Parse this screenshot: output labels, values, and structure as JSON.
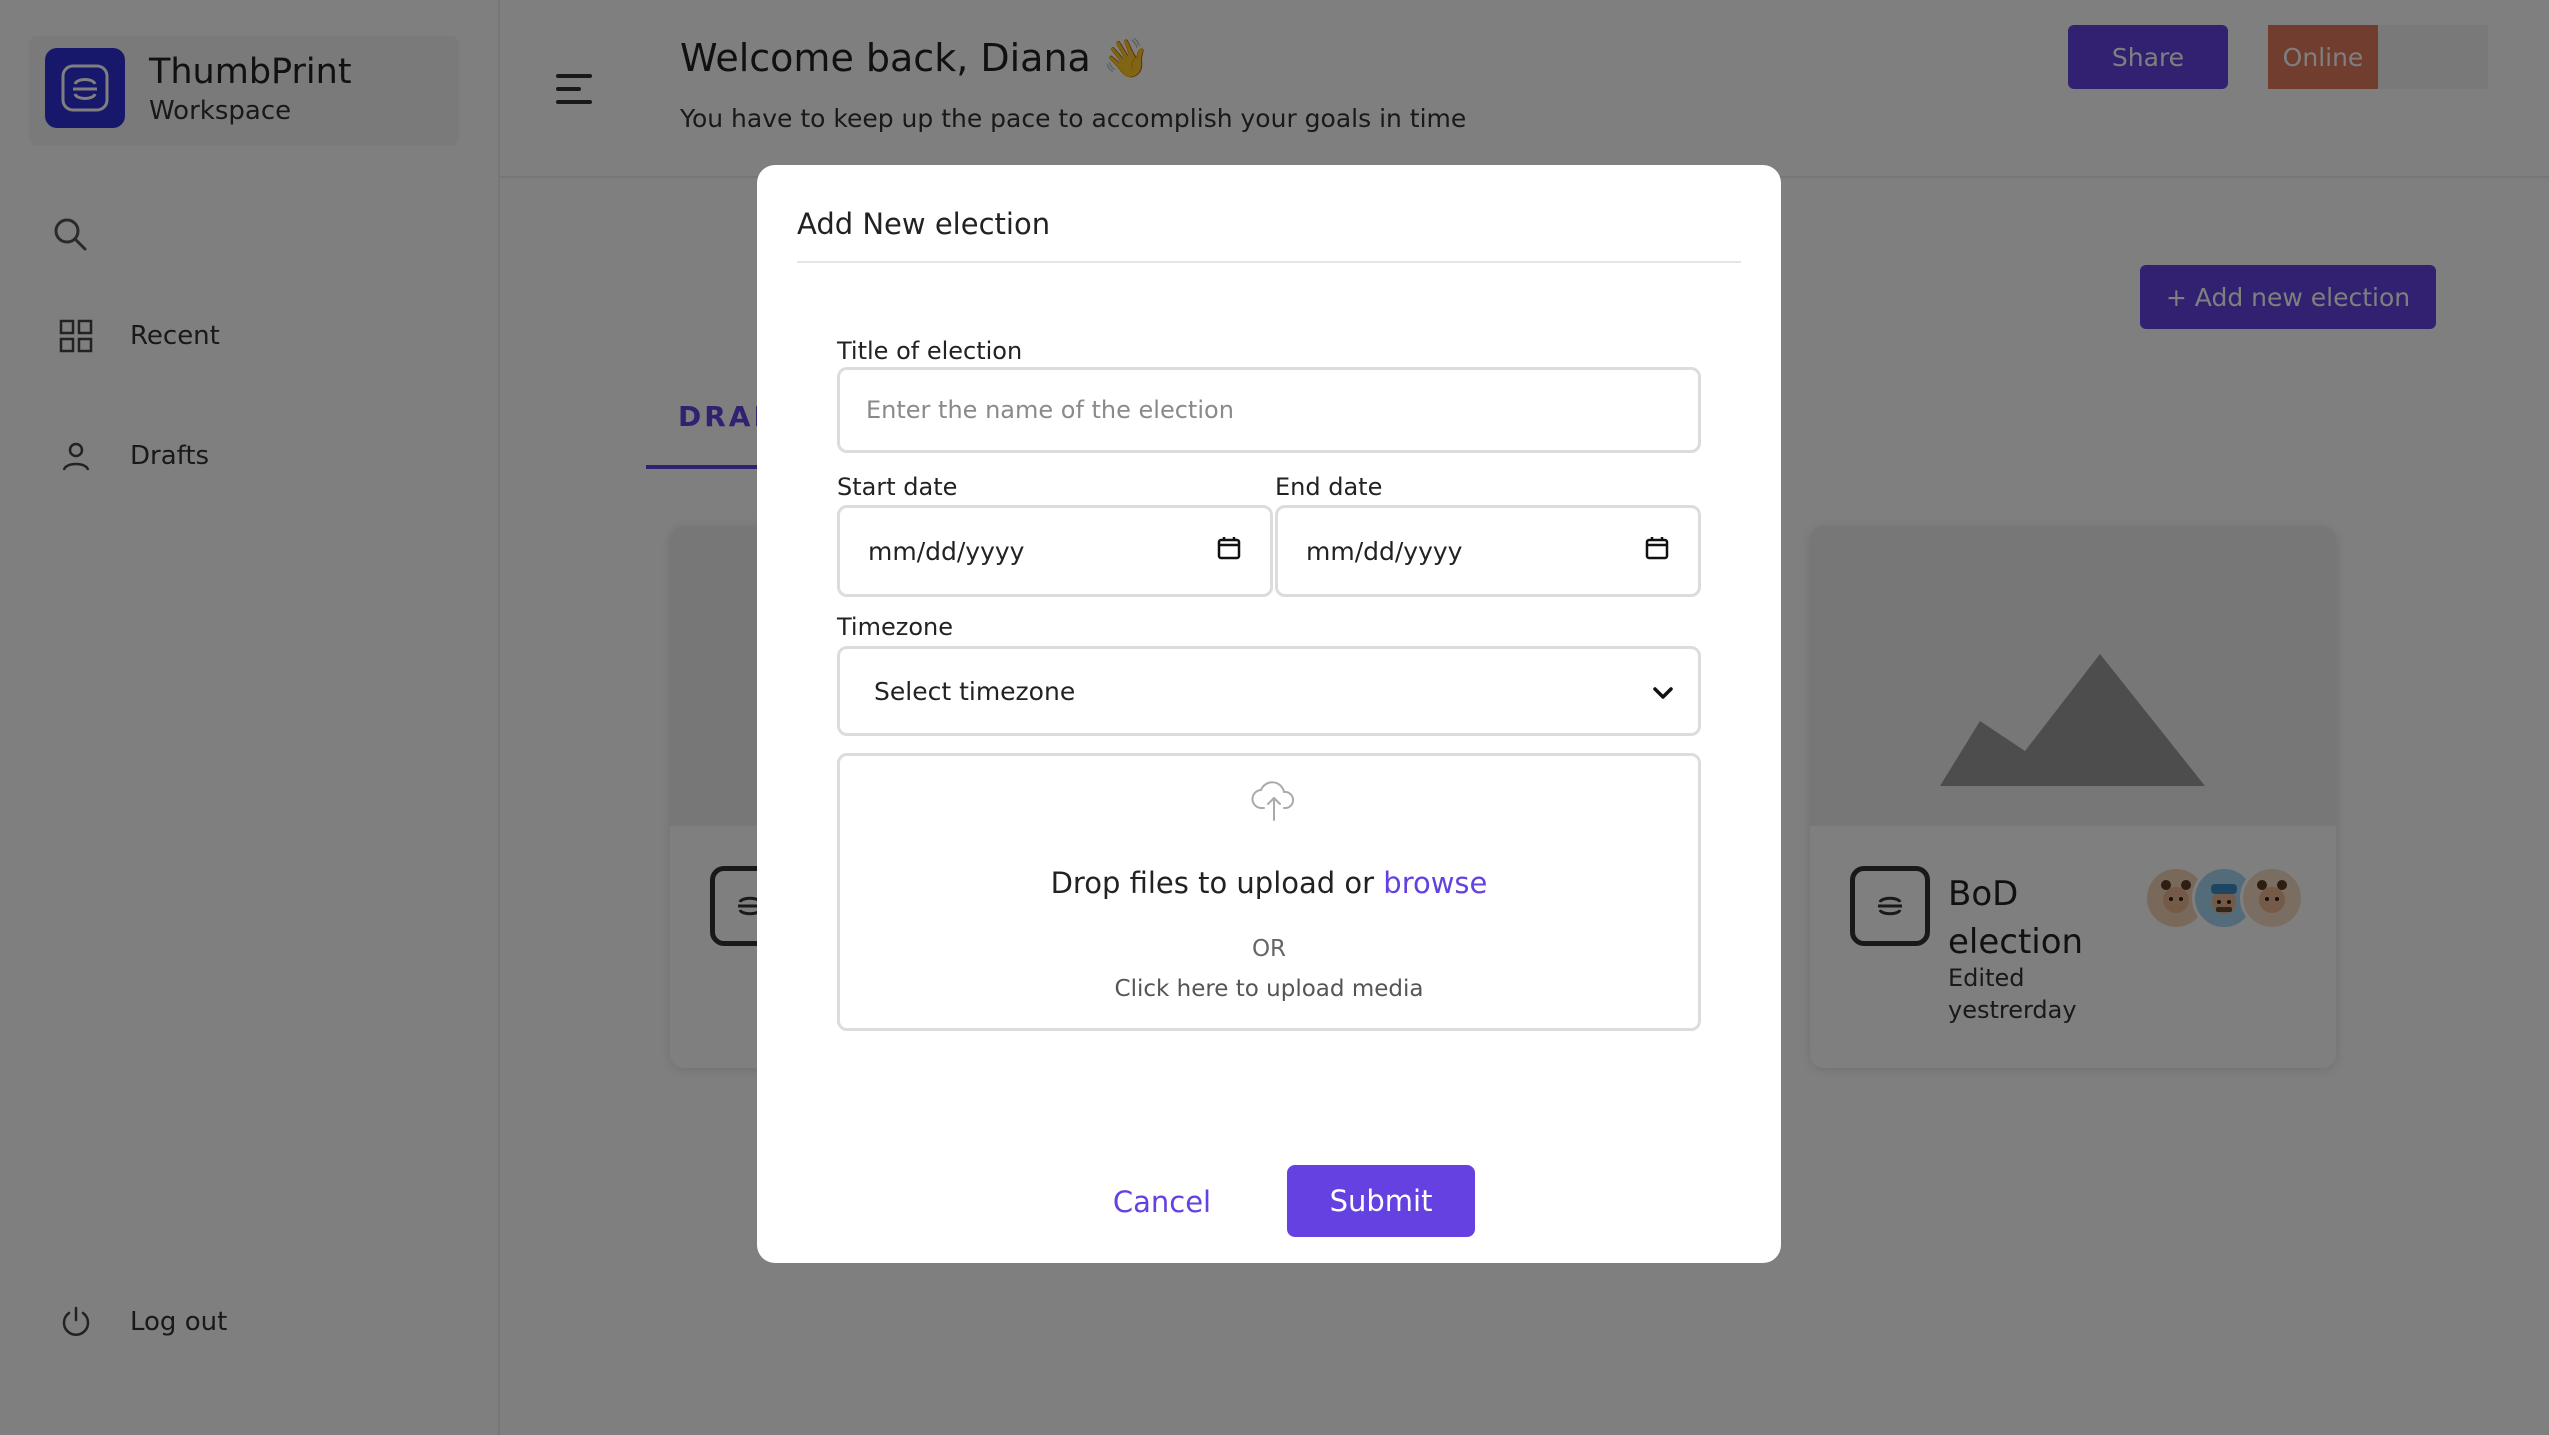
{
  "brand": {
    "name": "ThumbPrint",
    "subtitle": "Workspace"
  },
  "sidebar": {
    "items": [
      {
        "label": "Recent",
        "icon": "grid-icon"
      },
      {
        "label": "Drafts",
        "icon": "user-icon"
      }
    ],
    "logout_label": "Log out"
  },
  "header": {
    "welcome": "Welcome back, Diana 👋",
    "subtitle": "You have to keep up the pace to accomplish your goals in time",
    "share_label": "Share",
    "status_label": "Online"
  },
  "main": {
    "add_button_label": "+ Add new election",
    "tab_label": "DRAF",
    "cards": [
      {
        "title": "BoD election",
        "meta": "Edited yestrerday",
        "avatars": [
          "avatar-1",
          "avatar-2",
          "avatar-3"
        ]
      }
    ]
  },
  "modal": {
    "title": "Add New election",
    "title_field": {
      "label": "Title of election",
      "placeholder": "Enter the name of the election",
      "value": ""
    },
    "start_date": {
      "label": "Start date",
      "value": "mm/dd/yyyy"
    },
    "end_date": {
      "label": "End date",
      "value": "mm/dd/yyyy"
    },
    "timezone": {
      "label": "Timezone",
      "value": "Select timezone"
    },
    "upload": {
      "drop_text": "Drop files to upload or",
      "browse_label": "browse",
      "or_text": "OR",
      "click_text": "Click here to upload media"
    },
    "cancel_label": "Cancel",
    "submit_label": "Submit"
  },
  "colors": {
    "accent": "#6441e0",
    "brand_logo": "#2f2fd8",
    "status_online": "#e07a5f",
    "overlay": "rgba(0,0,0,0.5)"
  }
}
